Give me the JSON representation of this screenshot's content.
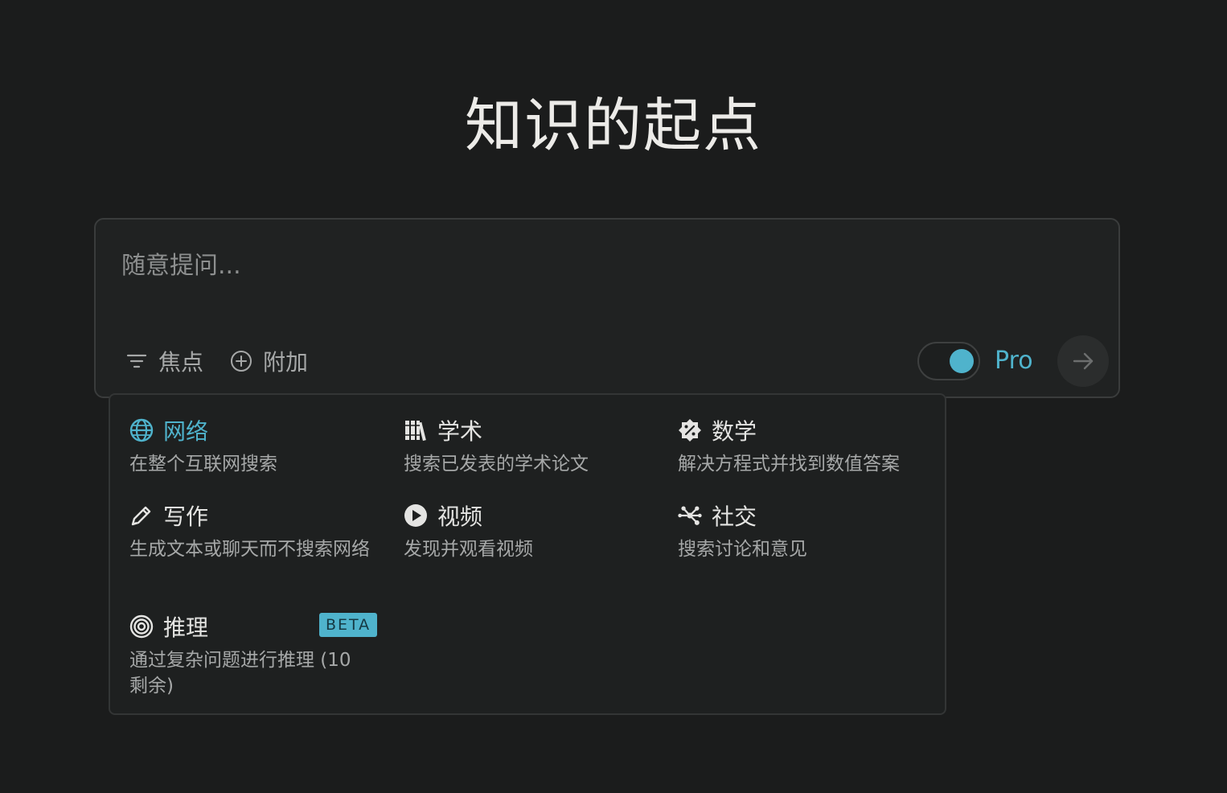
{
  "page": {
    "title": "知识的起点"
  },
  "search": {
    "placeholder": "随意提问...",
    "value": "",
    "focus_label": "焦点",
    "attach_label": "附加",
    "pro_label": "Pro",
    "pro_enabled": true
  },
  "focus_menu": {
    "options": [
      {
        "id": "web",
        "title": "网络",
        "desc": "在整个互联网搜索",
        "icon": "globe-icon",
        "active": true
      },
      {
        "id": "academic",
        "title": "学术",
        "desc": "搜索已发表的学术论文",
        "icon": "books-icon",
        "active": false
      },
      {
        "id": "math",
        "title": "数学",
        "desc": "解决方程式并找到数值答案",
        "icon": "percent-badge-icon",
        "active": false
      },
      {
        "id": "writing",
        "title": "写作",
        "desc": "生成文本或聊天而不搜索网络",
        "icon": "pencil-icon",
        "active": false
      },
      {
        "id": "video",
        "title": "视频",
        "desc": "发现并观看视频",
        "icon": "play-circle-icon",
        "active": false
      },
      {
        "id": "social",
        "title": "社交",
        "desc": "搜索讨论和意见",
        "icon": "network-icon",
        "active": false
      },
      {
        "id": "reasoning",
        "title": "推理",
        "desc": "通过复杂问题进行推理 (10 剩余)",
        "icon": "target-icon",
        "badge": "BETA",
        "active": false
      }
    ]
  },
  "colors": {
    "background": "#1b1c1c",
    "accent": "#4fb3cc",
    "panel": "#202222",
    "muted_text": "#a6a8a8"
  }
}
